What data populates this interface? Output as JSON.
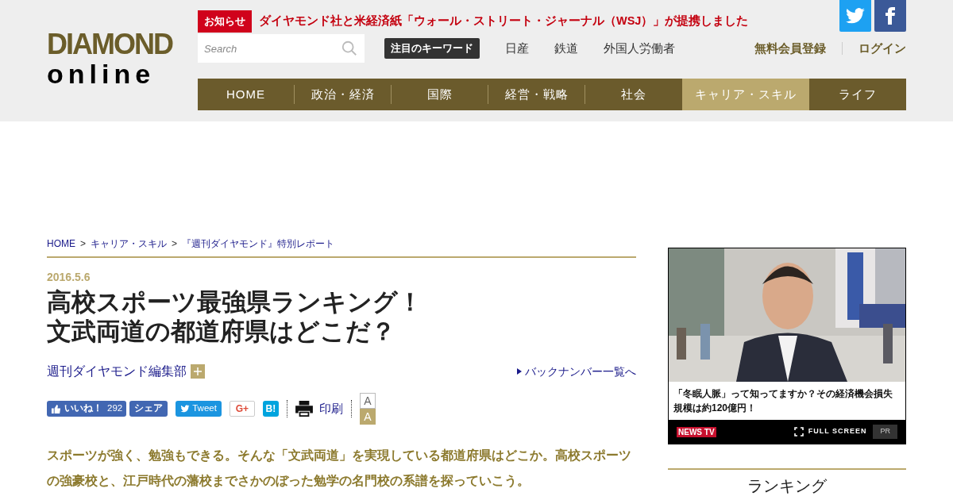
{
  "header": {
    "logo": {
      "line1": "DIAMOND",
      "line2": "online"
    },
    "notice": {
      "badge": "お知らせ",
      "text": "ダイヤモンド社と米経済紙「ウォール・ストリート・ジャーナル（WSJ）」が提携しました"
    },
    "search": {
      "placeholder": "Search"
    },
    "keywords": {
      "label": "注目のキーワード",
      "items": [
        "日産",
        "鉄道",
        "外国人労働者"
      ]
    },
    "account": [
      "無料会員登録",
      "ログイン"
    ],
    "nav": [
      {
        "label": "HOME",
        "selected": false
      },
      {
        "label": "政治・経済",
        "selected": false
      },
      {
        "label": "国際",
        "selected": false
      },
      {
        "label": "経営・戦略",
        "selected": false
      },
      {
        "label": "社会",
        "selected": false
      },
      {
        "label": "キャリア・スキル",
        "selected": true
      },
      {
        "label": "ライフ",
        "selected": false
      }
    ]
  },
  "breadcrumb": {
    "separator": ">",
    "items": [
      "HOME",
      "キャリア・スキル",
      "『週刊ダイヤモンド』特別レポート"
    ]
  },
  "article": {
    "date": "2016.5.6",
    "title_lines": [
      "高校スポーツ最強県ランキング！",
      "文武両道の都道府県はどこだ？"
    ],
    "author": "週刊ダイヤモンド編集部",
    "backnumber": "バックナンバー一覧へ",
    "share": {
      "like": "いいね！",
      "like_count": "292",
      "share": "シェア",
      "tweet": "Tweet",
      "gplus": "G+",
      "hatena": "B!",
      "print": "印刷"
    },
    "font_sizes": [
      {
        "label": "A",
        "selected": false
      },
      {
        "label": "A",
        "selected": true
      }
    ],
    "lead": "スポーツが強く、勉強もできる。そんな「文武両道」を実現している都道府県はどこか。高校スポーツの強豪校と、江戸時代の藩校までさかのぼった勉学の名門校の系譜を探っていこう。"
  },
  "sidebar": {
    "video": {
      "kind": "picture",
      "caption": "「冬眠人脈」って知ってますか？その経済機会損失規模は約120億円！",
      "brand": "NEWS TV",
      "fullscreen": "FULL SCREEN",
      "pr": "PR"
    },
    "ranking_title": "ランキング"
  }
}
